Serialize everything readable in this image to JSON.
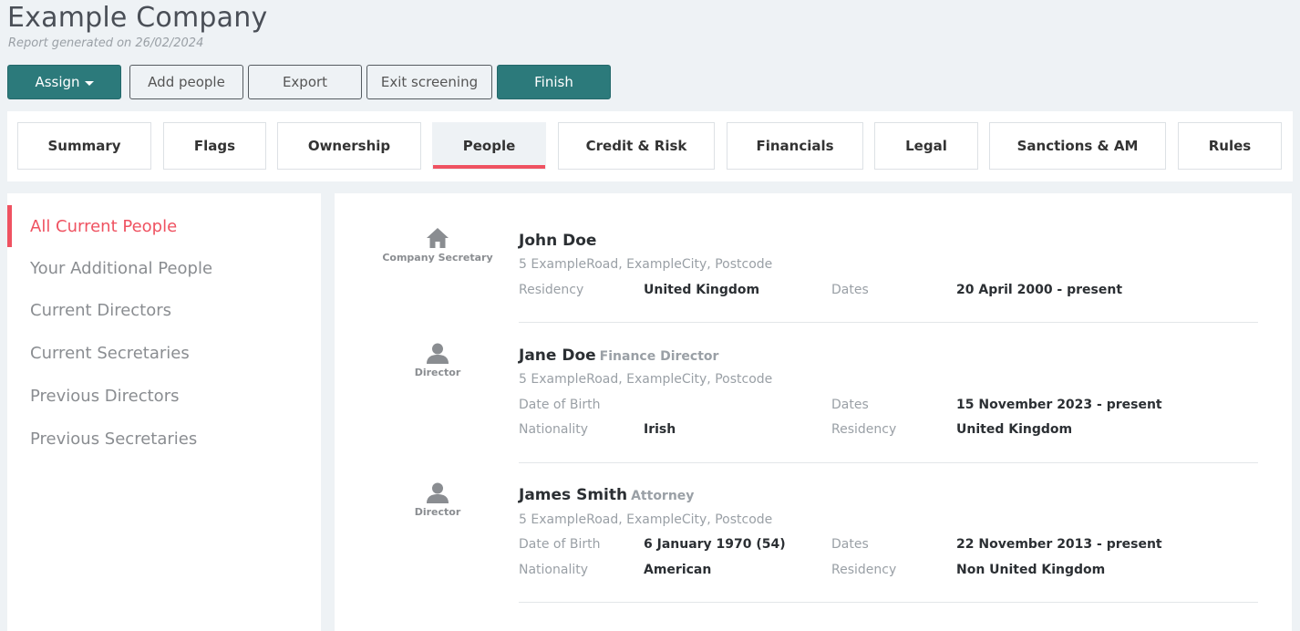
{
  "company": {
    "title": "Example Company",
    "report_date": "Report generated on 26/02/2024"
  },
  "actions": {
    "assign": "Assign",
    "add_people": "Add people",
    "export": "Export",
    "exit_screening": "Exit screening",
    "finish": "Finish"
  },
  "tabs": [
    {
      "label": "Summary"
    },
    {
      "label": "Flags"
    },
    {
      "label": "Ownership"
    },
    {
      "label": "People",
      "active": true
    },
    {
      "label": "Credit & Risk"
    },
    {
      "label": "Financials"
    },
    {
      "label": "Legal"
    },
    {
      "label": "Sanctions & AM"
    },
    {
      "label": "Rules"
    }
  ],
  "sidebar": {
    "items": [
      {
        "label": "All Current People",
        "active": true
      },
      {
        "label": "Your Additional People"
      },
      {
        "label": "Current Directors"
      },
      {
        "label": "Current Secretaries"
      },
      {
        "label": "Previous Directors"
      },
      {
        "label": "Previous Secretaries"
      }
    ]
  },
  "people": [
    {
      "icon": "home-icon",
      "role": "Company Secretary",
      "name": "John Doe",
      "subtitle": "",
      "address": "5 ExampleRoad, ExampleCity, Postcode",
      "rows": [
        {
          "l1": "Residency",
          "v1": "United Kingdom",
          "l2": "Dates",
          "v2": "20 April 2000 - present"
        }
      ]
    },
    {
      "icon": "person-icon",
      "role": "Director",
      "name": "Jane Doe",
      "subtitle": "Finance Director",
      "address": "5 ExampleRoad, ExampleCity, Postcode",
      "rows": [
        {
          "l1": "Date of Birth",
          "v1": "",
          "l2": "Dates",
          "v2": "15 November 2023 - present"
        },
        {
          "l1": "Nationality",
          "v1": "Irish",
          "l2": "Residency",
          "v2": "United Kingdom"
        }
      ]
    },
    {
      "icon": "person-icon",
      "role": "Director",
      "name": "James Smith",
      "subtitle": "Attorney",
      "address": "5 ExampleRoad, ExampleCity, Postcode",
      "rows": [
        {
          "l1": "Date of Birth",
          "v1": "6 January 1970 (54)",
          "l2": "Dates",
          "v2": "22 November 2013 - present"
        },
        {
          "l1": "Nationality",
          "v1": "American",
          "l2": "Residency",
          "v2": "Non United Kingdom"
        }
      ]
    }
  ],
  "colors": {
    "accent": "#ef5261",
    "primary": "#2c7a7b",
    "background": "#eef2f5"
  }
}
